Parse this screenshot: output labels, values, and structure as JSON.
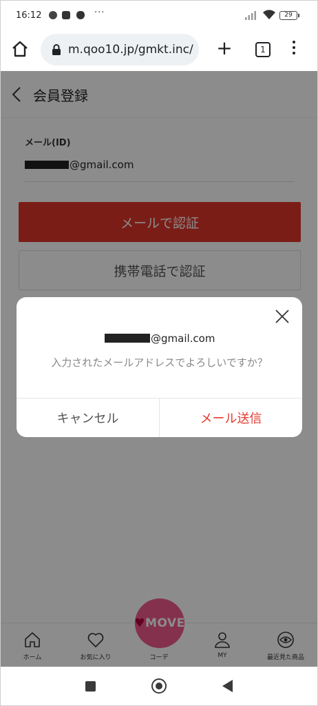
{
  "status_bar": {
    "time": "16:12",
    "more_indicator": "···",
    "battery": "29",
    "icons": [
      "line-icon",
      "youtube-icon",
      "cat-icon",
      "signal-icon",
      "wifi-icon",
      "battery-icon"
    ]
  },
  "browser": {
    "url": "m.qoo10.jp/gmkt.inc/",
    "tab_count": "1",
    "new_tab_symbol": "+"
  },
  "page": {
    "title": "会員登録",
    "email_label": "メール(ID)",
    "email_domain": "@gmail.com",
    "email_verify_button": "メールで認証",
    "phone_verify_button": "携帯電話で認証"
  },
  "dialog": {
    "email_domain": "@gmail.com",
    "question": "入力されたメールアドレスでよろしいですか？",
    "cancel_button": "キャンセル",
    "send_button": "メール送信"
  },
  "app_nav": {
    "items": [
      {
        "label": "ホーム",
        "icon": "home-icon"
      },
      {
        "label": "お気に入り",
        "icon": "heart-icon"
      },
      {
        "label": "コーデ",
        "icon": "move-icon"
      },
      {
        "label": "MY",
        "icon": "person-icon"
      },
      {
        "label": "最近見た商品",
        "icon": "eye-icon"
      }
    ],
    "center_logo": "MOVE"
  },
  "colors": {
    "accent_red": "#e0362b",
    "send_red": "#e53a2f",
    "move_pink": "#f05a8e"
  }
}
